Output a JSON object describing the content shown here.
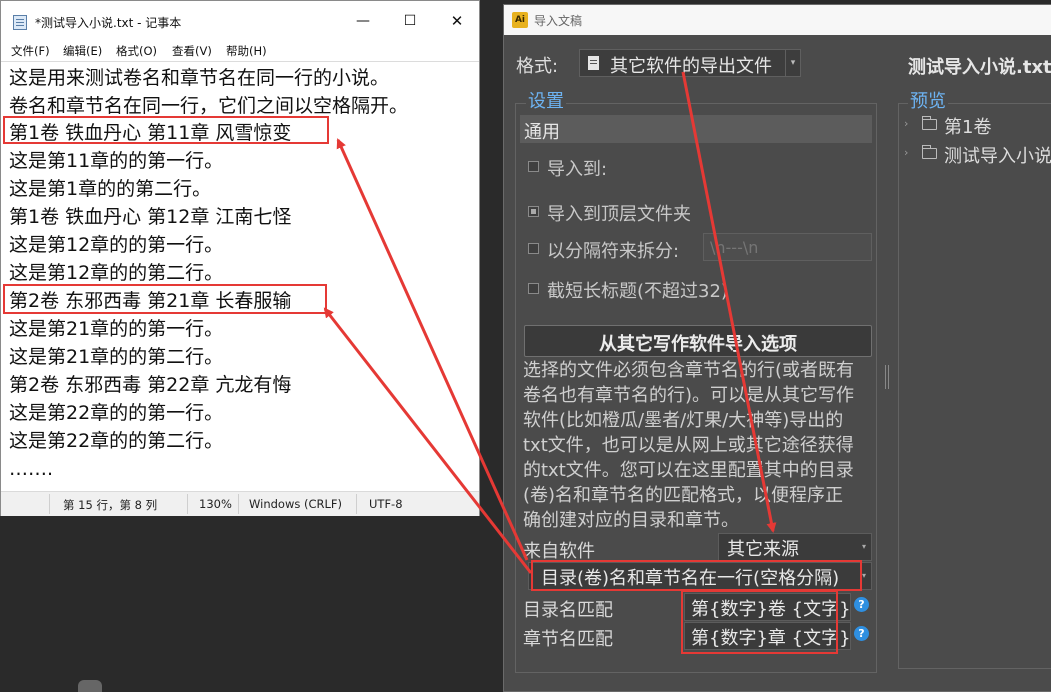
{
  "notepad": {
    "title": "*测试导入小说.txt - 记事本",
    "controls": {
      "minimize": "—",
      "maximize": "☐",
      "close": "✕"
    },
    "menu": [
      "文件(F)",
      "编辑(E)",
      "格式(O)",
      "查看(V)",
      "帮助(H)"
    ],
    "lines": [
      "这是用来测试卷名和章节名在同一行的小说。",
      "卷名和章节名在同一行，它们之间以空格隔开。",
      "第1卷 铁血丹心 第11章 风雪惊变",
      "这是第11章的的第一行。",
      "这是第1章的的第二行。",
      "第1卷 铁血丹心 第12章 江南七怪",
      "这是第12章的的第一行。",
      "这是第12章的的第二行。",
      "第2卷 东邪西毒 第21章 长春服输",
      "这是第21章的的第一行。",
      "这是第21章的的第二行。",
      "第2卷 东邪西毒 第22章 亢龙有悔",
      "这是第22章的的第一行。",
      "这是第22章的的第二行。",
      "……."
    ],
    "status": {
      "position": "第 15 行，第 8 列",
      "zoom": "130%",
      "line_ending": "Windows (CRLF)",
      "encoding": "UTF-8"
    }
  },
  "dialog": {
    "app_icon": "Ai",
    "title": "导入文稿",
    "format_label": "格式:",
    "format_value": "其它软件的导出文件",
    "settings_legend": "设置",
    "general_label": "通用",
    "options": {
      "import_to": "导入到:",
      "import_to_top": "导入到顶层文件夹",
      "split_by_separator": "以分隔符来拆分:",
      "separator_placeholder": "\\n---\\n",
      "truncate_title": "截短长标题(不超过32)"
    },
    "other_software_button": "从其它写作软件导入选项",
    "description_lines": [
      "选择的文件必须包含章节名的行(或者既有",
      "卷名也有章节名的行)。可以是从其它写作",
      "软件(比如橙瓜/墨者/灯果/大神等)导出的",
      "txt文件，也可以是从网上或其它途径获得",
      "的txt文件。您可以在这里配置其中的目录",
      "(卷)名和章节名的匹配格式，以便程序正",
      "确创建对应的目录和章节。"
    ],
    "source_label": "来自软件",
    "source_value": "其它来源",
    "mode_value": "目录(卷)名和章节名在一行(空格分隔)",
    "volume_match_label": "目录名匹配",
    "volume_match_value": "第{数字}卷 {文字}",
    "chapter_match_label": "章节名匹配",
    "chapter_match_value": "第{数字}章 {文字}",
    "help_glyph": "?",
    "preview_title": "测试导入小说.txt",
    "preview_legend": "预览",
    "preview_items": [
      "第1卷",
      "测试导入小说"
    ]
  },
  "colors": {
    "annotation": "#e53935",
    "dialog_bg": "#4b4b4b",
    "legend": "#6db3f2",
    "help": "#2f8fe0"
  }
}
